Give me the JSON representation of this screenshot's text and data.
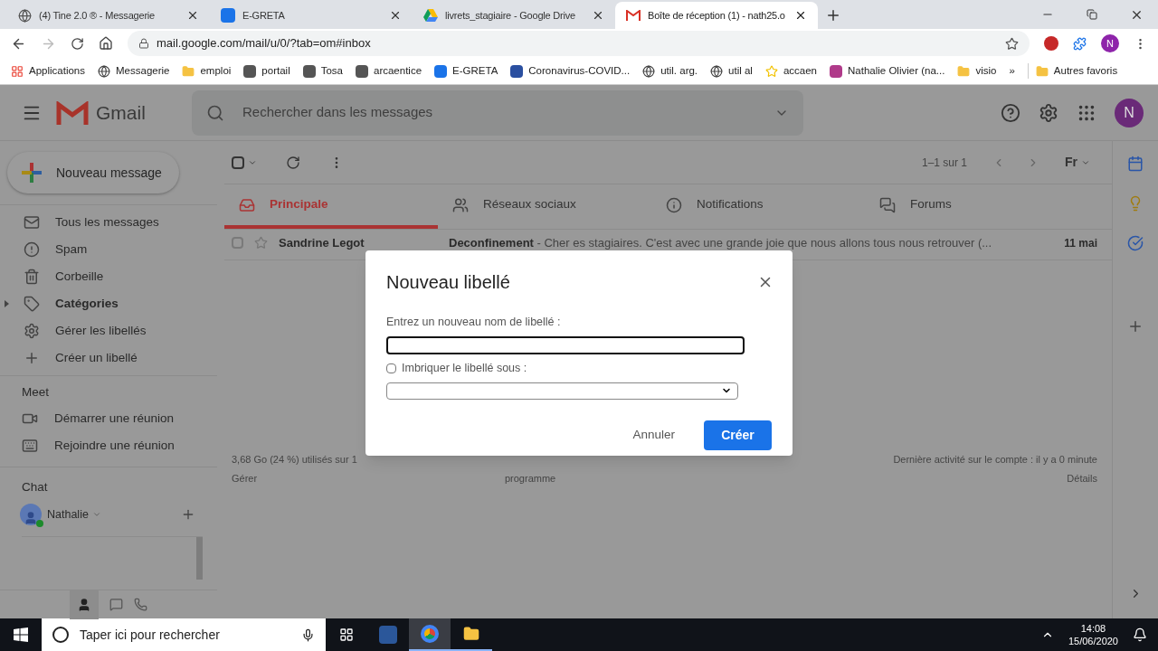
{
  "browser": {
    "tabs": [
      {
        "title": "(4) Tine 2.0 ® - Messagerie",
        "selected": false
      },
      {
        "title": "E-GRETA",
        "selected": false
      },
      {
        "title": "livrets_stagiaire - Google Drive",
        "selected": false
      },
      {
        "title": "Boîte de réception (1) - nath25.o",
        "selected": true
      }
    ],
    "address": "mail.google.com/mail/u/0/?tab=om#inbox",
    "profile_letter": "N",
    "bookmarks": [
      "Applications",
      "Messagerie",
      "emploi",
      "portail",
      "Tosa",
      "arcaentice",
      "E-GRETA",
      "Coronavirus-COVID...",
      "util. arg.",
      "util al",
      "accaen",
      "Nathalie Olivier (na...",
      "visio"
    ],
    "bookmarks_overflow": "»",
    "other_bookmarks": "Autres favoris"
  },
  "gmail": {
    "app_name": "Gmail",
    "search_placeholder": "Rechercher dans les messages",
    "avatar_letter": "N",
    "compose": "Nouveau message",
    "nav": [
      {
        "label": "Tous les messages",
        "bold": false,
        "expander": false
      },
      {
        "label": "Spam",
        "bold": false,
        "expander": false
      },
      {
        "label": "Corbeille",
        "bold": false,
        "expander": false
      },
      {
        "label": "Catégories",
        "bold": true,
        "expander": true
      },
      {
        "label": "Gérer les libellés",
        "bold": false,
        "expander": false
      },
      {
        "label": "Créer un libellé",
        "bold": false,
        "expander": false
      }
    ],
    "meet": {
      "heading": "Meet",
      "items": [
        "Démarrer une réunion",
        "Rejoindre une réunion"
      ]
    },
    "chat": {
      "heading": "Chat",
      "user": "Nathalie"
    },
    "toolbar": {
      "select_all_checked": false,
      "count": "1–1 sur 1",
      "input_tool": "Fr"
    },
    "category_tabs": [
      {
        "label": "Principale",
        "selected": true
      },
      {
        "label": "Réseaux sociaux",
        "selected": false
      },
      {
        "label": "Notifications",
        "selected": false
      },
      {
        "label": "Forums",
        "selected": false
      }
    ],
    "emails": [
      {
        "sender": "Sandrine Legot",
        "subject": "Deconfinement",
        "snippet": " - Cher es stagiaires. C'est avec une grande joie que nous allons tous nous retrouver (...",
        "date": "11 mai",
        "unread": true,
        "checked": false
      }
    ],
    "footer": {
      "storage": "3,68 Go (24 %) utilisés sur 1",
      "manage": "Gérer",
      "programme": "programme",
      "activity": "Dernière activité sur le compte : il y a 0 minute",
      "details": "Détails"
    }
  },
  "dialog": {
    "title": "Nouveau libellé",
    "field_label": "Entrez un nouveau nom de libellé :",
    "nest_label": "Imbriquer le libellé sous :",
    "nest_checked": false,
    "cancel": "Annuler",
    "create": "Créer"
  },
  "taskbar": {
    "search_placeholder": "Taper ici pour rechercher",
    "time": "14:08",
    "date": "15/06/2020"
  }
}
